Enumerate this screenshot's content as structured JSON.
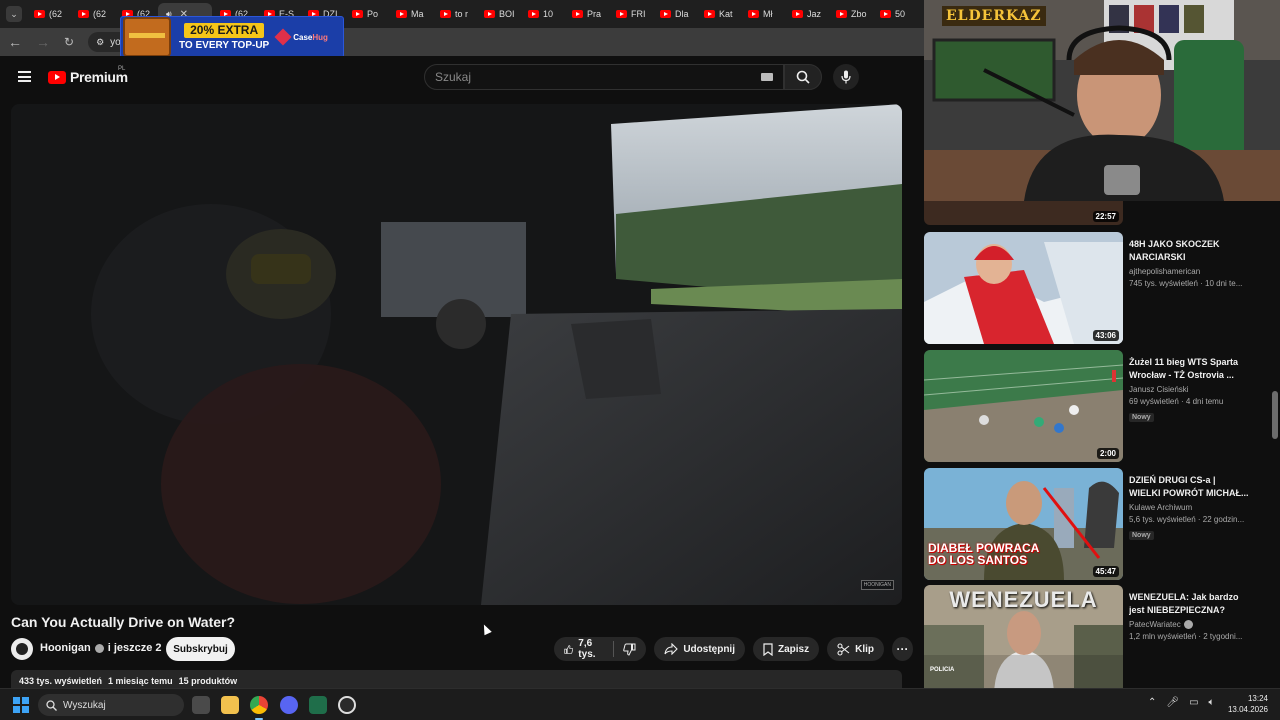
{
  "browser": {
    "tabs": [
      "(62",
      "(62",
      "(62",
      "",
      "(62",
      "E-S",
      "DZI",
      "Po",
      "Ma",
      "to r",
      "BOI",
      "10",
      "Pra",
      "FRI",
      "Dla",
      "Kat",
      "Mł",
      "Jaz",
      "Zbo",
      "50"
    ],
    "address": "you"
  },
  "ad": {
    "headline": "20% EXTRA",
    "subline": "TO EVERY TOP-UP",
    "brand_a": "Case",
    "brand_b": "Hug"
  },
  "header": {
    "logo_text": "Premium",
    "region": "PL",
    "search_placeholder": "Szukaj"
  },
  "player": {
    "watermark": "HOONIGAN"
  },
  "video": {
    "title": "Can You Actually Drive on Water?",
    "channel": "Hoonigan",
    "collab": "i jeszcze 2",
    "subscribe_label": "Subskrybuj",
    "likes": "7,6 tys.",
    "share_label": "Udostępnij",
    "save_label": "Zapisz",
    "clip_label": "Klip",
    "views": "433 tys. wyświetleń",
    "age": "1 miesiąc temu",
    "products": "15 produktów"
  },
  "webcam": {
    "overlay": "ELDERKAZ"
  },
  "recommendations": [
    {
      "duration": "22:57",
      "title": "",
      "channel": "",
      "stats": "",
      "badge": ""
    },
    {
      "duration": "43:06",
      "title": "48H JAKO SKOCZEK NARCIARSKI",
      "channel": "ajthepolishamerican",
      "stats": "745 tys. wyświetleń · 10 dni te...",
      "badge": ""
    },
    {
      "duration": "2:00",
      "title": "Żużel 11 bieg WTS Sparta Wrocław - TŻ Ostrovia ...",
      "channel": "Janusz Cisieński",
      "stats": "69 wyświetleń · 4 dni temu",
      "badge": "Nowy"
    },
    {
      "duration": "45:47",
      "title": "DZIEŃ DRUGI CS-a | WIELKI POWRÓT MICHAŁ...",
      "channel": "Kulawe Archiwum",
      "stats": "5,6 tys. wyświetleń · 22 godzin...",
      "badge": "Nowy",
      "thumb_text_a": "DIABEŁ POWRACA",
      "thumb_text_b": "DO LOS SANTOS"
    },
    {
      "duration": "",
      "title": "WENEZUELA: Jak bardzo jest NIEBEZPIECZNA?",
      "channel": "PatecWariatec",
      "stats": "1,2 mln wyświetleń · 2 tygodni...",
      "badge": "",
      "thumb_text_a": "WENEZUELA",
      "thumb_text_b": "POLICIA"
    }
  ],
  "taskbar": {
    "search_placeholder": "Wyszukaj",
    "time": "13:24",
    "date": "13.04.2026"
  }
}
